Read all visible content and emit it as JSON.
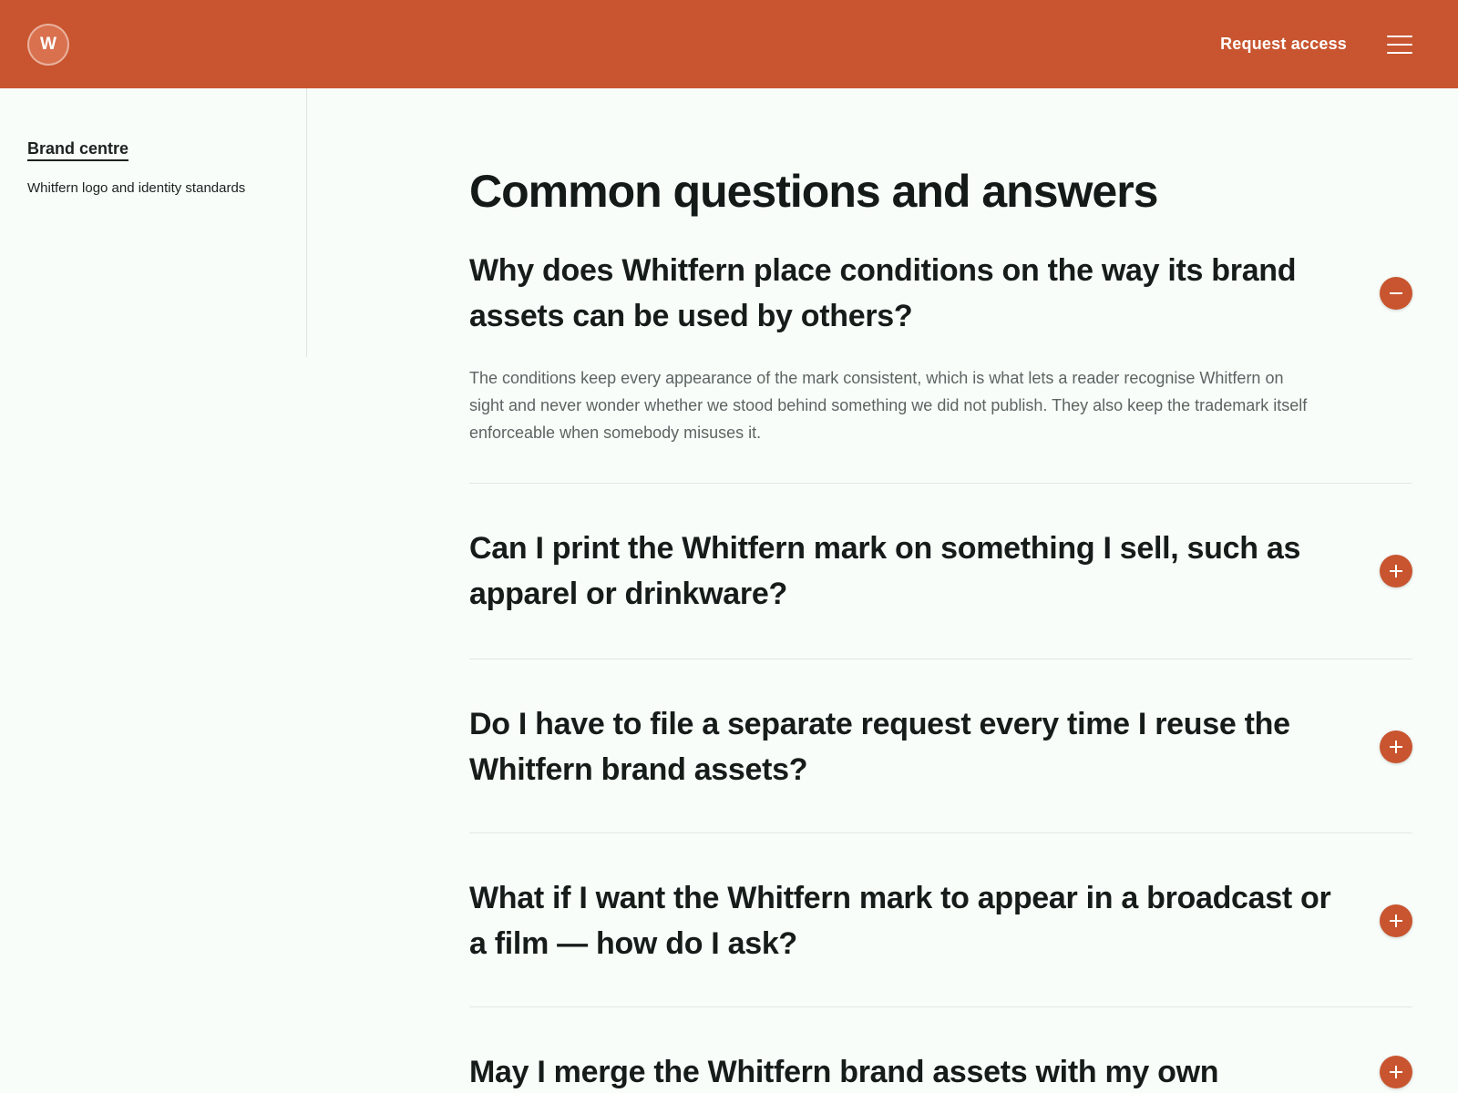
{
  "header": {
    "logo_letter": "W",
    "request_access": "Request access",
    "menu_icon": "hamburger-menu-icon",
    "brand_color": "#c8552f"
  },
  "sidebar": {
    "title": "Brand centre",
    "subtitle": "Whitfern logo and identity standards"
  },
  "main": {
    "title": "Common questions and answers",
    "faqs": [
      {
        "question": "Why does Whitfern place conditions on the way its brand assets can be used by others?",
        "answer": "The conditions keep every appearance of the mark consistent, which is what lets a reader recognise Whitfern on sight and never wonder whether we stood behind something we did not publish. They also keep the trademark itself enforceable when somebody misuses it.",
        "expanded": true,
        "toggle_icon": "minus-circle-icon"
      },
      {
        "question": "Can I print the Whitfern mark on something I sell, such as apparel or drinkware?",
        "expanded": false,
        "toggle_icon": "plus-circle-icon"
      },
      {
        "question": "Do I have to file a separate request every time I reuse the Whitfern brand assets?",
        "expanded": false,
        "toggle_icon": "plus-circle-icon"
      },
      {
        "question": "What if I want the Whitfern mark to appear in a broadcast or a film — how do I ask?",
        "expanded": false,
        "toggle_icon": "plus-circle-icon"
      },
      {
        "question": "May I merge the Whitfern brand assets with my own",
        "expanded": false,
        "toggle_icon": "plus-circle-icon"
      }
    ]
  }
}
